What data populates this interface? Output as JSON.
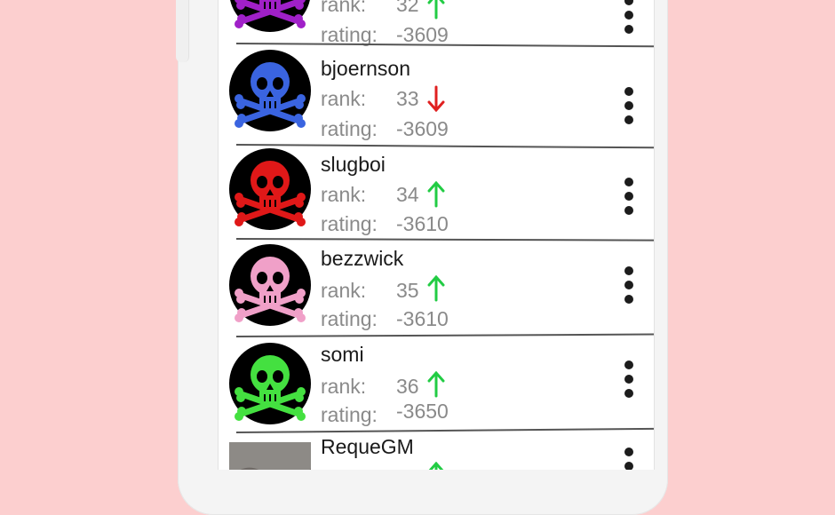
{
  "labels": {
    "rank": "rank:",
    "rating": "rating:"
  },
  "colors": {
    "up": "#22cc44",
    "down": "#e02020",
    "background": "#fccfcf"
  },
  "players": [
    {
      "name": "",
      "rank": "32",
      "rank_direction": "up",
      "rating": "-3609",
      "avatar_color": "#a020c8",
      "avatar_icon": "skull-crossbones-icon"
    },
    {
      "name": "bjoernson",
      "rank": "33",
      "rank_direction": "down",
      "rating": "-3609",
      "avatar_color": "#3a64e0",
      "avatar_icon": "skull-crossbones-icon"
    },
    {
      "name": "slugboi",
      "rank": "34",
      "rank_direction": "up",
      "rating": "-3610",
      "avatar_color": "#e01818",
      "avatar_icon": "skull-crossbones-icon"
    },
    {
      "name": "bezzwick",
      "rank": "35",
      "rank_direction": "up",
      "rating": "-3610",
      "avatar_color": "#f0a0c8",
      "avatar_icon": "skull-crossbones-icon"
    },
    {
      "name": "somi",
      "rank": "36",
      "rank_direction": "up",
      "rating": "-3650",
      "avatar_color": "#44e040",
      "avatar_icon": "skull-crossbones-icon"
    },
    {
      "name": "RequeGM",
      "rank": "",
      "rank_direction": "up",
      "rating": "",
      "avatar_color": "#8a8a8a",
      "avatar_icon": "photo-avatar"
    }
  ]
}
